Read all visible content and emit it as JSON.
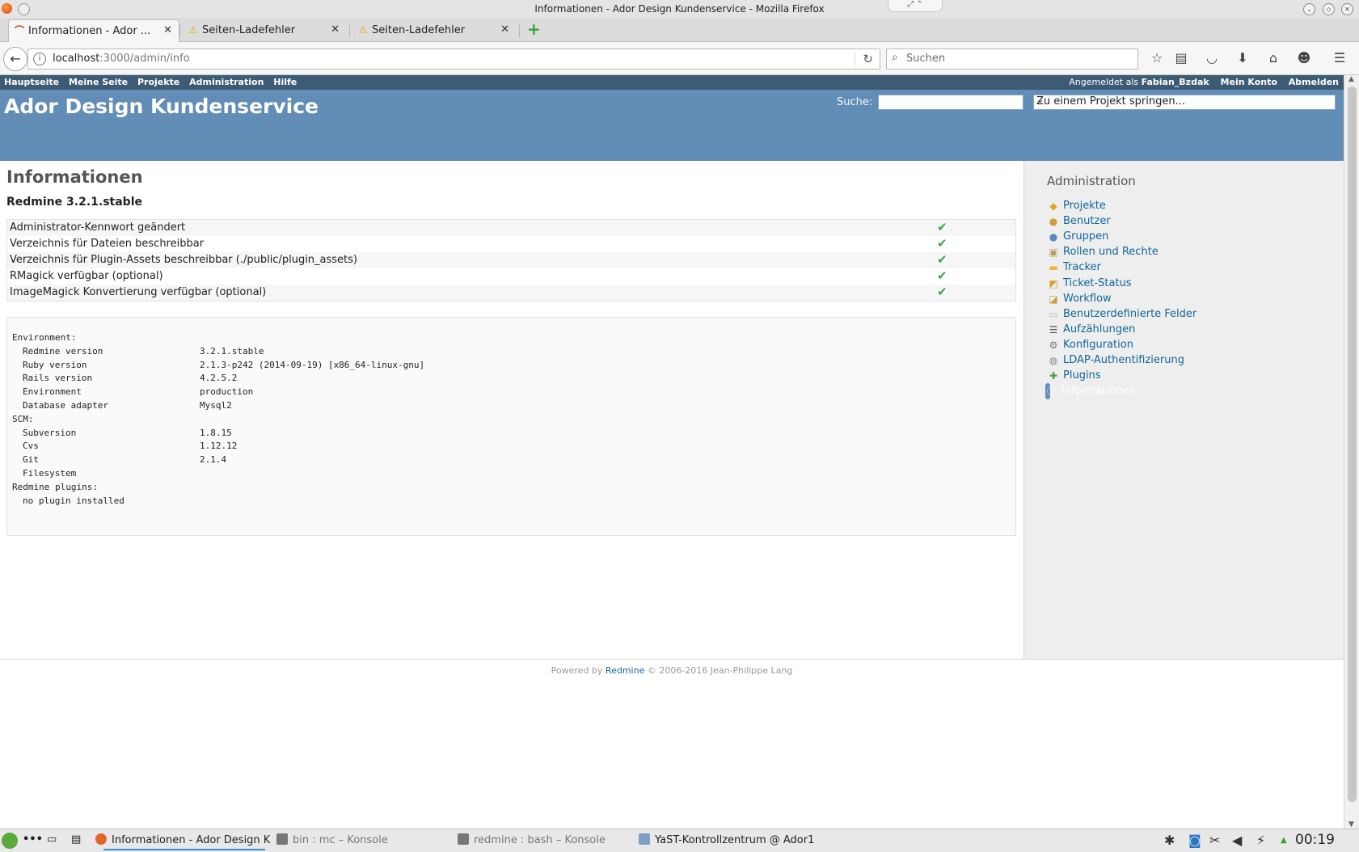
{
  "window": {
    "title": "Informationen - Ador Design Kundenservice - Mozilla Firefox"
  },
  "tabs": [
    {
      "label": "Informationen - Ador ...",
      "icon": "redmine-icon",
      "active": true
    },
    {
      "label": "Seiten-Ladefehler",
      "icon": "warning-icon",
      "active": false
    },
    {
      "label": "Seiten-Ladefehler",
      "icon": "warning-icon",
      "active": false
    }
  ],
  "navbar": {
    "url_host": "localhost",
    "url_rest": ":3000/admin/info",
    "search_placeholder": "Suchen"
  },
  "top_menu": {
    "left": [
      "Hauptseite",
      "Meine Seite",
      "Projekte",
      "Administration",
      "Hilfe"
    ],
    "logged_prefix": "Angemeldet als",
    "user": "Fabian_Bzdak",
    "my_account": "Mein Konto",
    "logout": "Abmelden"
  },
  "header": {
    "site_title": "Ador Design Kundenservice",
    "quick_search_label": "Suche:",
    "project_jump": "Zu einem Projekt springen..."
  },
  "main": {
    "heading": "Informationen",
    "version": "Redmine 3.2.1.stable",
    "checks": [
      {
        "label": "Administrator-Kennwort geändert",
        "ok": true
      },
      {
        "label": "Verzeichnis für Dateien beschreibbar",
        "ok": true
      },
      {
        "label": "Verzeichnis für Plugin-Assets beschreibbar (./public/plugin_assets)",
        "ok": true
      },
      {
        "label": "RMagick verfügbar (optional)",
        "ok": true
      },
      {
        "label": "ImageMagick Konvertierung verfügbar (optional)",
        "ok": true
      }
    ],
    "environment": [
      {
        "key": "Environment:",
        "value": "",
        "indent": false
      },
      {
        "key": "Redmine version",
        "value": "3.2.1.stable",
        "indent": true
      },
      {
        "key": "Ruby version",
        "value": "2.1.3-p242 (2014-09-19) [x86_64-linux-gnu]",
        "indent": true
      },
      {
        "key": "Rails version",
        "value": "4.2.5.2",
        "indent": true
      },
      {
        "key": "Environment",
        "value": "production",
        "indent": true
      },
      {
        "key": "Database adapter",
        "value": "Mysql2",
        "indent": true
      },
      {
        "key": "SCM:",
        "value": "",
        "indent": false
      },
      {
        "key": "Subversion",
        "value": "1.8.15",
        "indent": true
      },
      {
        "key": "Cvs",
        "value": "1.12.12",
        "indent": true
      },
      {
        "key": "Git",
        "value": "2.1.4",
        "indent": true
      },
      {
        "key": "Filesystem",
        "value": "",
        "indent": true
      },
      {
        "key": "Redmine plugins:",
        "value": "",
        "indent": false
      },
      {
        "key": "no plugin installed",
        "value": "",
        "indent": true
      }
    ]
  },
  "sidebar": {
    "heading": "Administration",
    "items": [
      {
        "label": "Projekte",
        "icon": "projects-icon",
        "glyph": "◆",
        "color": "#e4a21f"
      },
      {
        "label": "Benutzer",
        "icon": "user-icon",
        "glyph": "●",
        "color": "#d39b3a"
      },
      {
        "label": "Gruppen",
        "icon": "group-icon",
        "glyph": "●",
        "color": "#5c87c4"
      },
      {
        "label": "Rollen und Rechte",
        "icon": "roles-icon",
        "glyph": "▣",
        "color": "#b79a6a"
      },
      {
        "label": "Tracker",
        "icon": "tracker-icon",
        "glyph": "▬",
        "color": "#e6b83c"
      },
      {
        "label": "Ticket-Status",
        "icon": "ticket-status-icon",
        "glyph": "◩",
        "color": "#d9a22c"
      },
      {
        "label": "Workflow",
        "icon": "workflow-icon",
        "glyph": "◪",
        "color": "#c9a13b"
      },
      {
        "label": "Benutzerdefinierte Felder",
        "icon": "custom-fields-icon",
        "glyph": "▭",
        "color": "#bbbbbb"
      },
      {
        "label": "Aufzählungen",
        "icon": "enumerations-icon",
        "glyph": "☰",
        "color": "#555555"
      },
      {
        "label": "Konfiguration",
        "icon": "settings-icon",
        "glyph": "⚙",
        "color": "#777777"
      },
      {
        "label": "LDAP-Authentifizierung",
        "icon": "ldap-icon",
        "glyph": "◍",
        "color": "#8a8a8a"
      },
      {
        "label": "Plugins",
        "icon": "plugin-icon",
        "glyph": "✚",
        "color": "#4f9a3a"
      },
      {
        "label": "Informationen",
        "icon": "info-icon",
        "glyph": "ⓘ",
        "color": "#ffffff",
        "selected": true
      }
    ]
  },
  "footer": {
    "powered_by": "Powered by",
    "redmine": "Redmine",
    "copyright": "© 2006-2016 Jean-Philippe Lang"
  },
  "taskbar": {
    "tasks": [
      {
        "label": "Informationen - Ador Design K",
        "icon": "firefox-icon",
        "active": true
      },
      {
        "label": "bin : mc – Konsole",
        "icon": "terminal-icon",
        "active": false
      },
      {
        "label": "redmine : bash – Konsole",
        "icon": "terminal-icon",
        "active": false
      },
      {
        "label": "YaST-Kontrollzentrum @ Ador1",
        "icon": "yast-icon",
        "active": false
      }
    ],
    "clock": "00:19"
  }
}
